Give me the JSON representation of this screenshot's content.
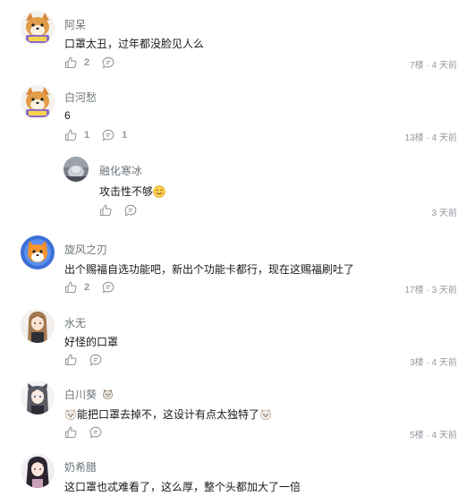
{
  "comments": [
    {
      "user": "阿呆",
      "text": "口罩太丑，过年都没脸见人么",
      "likes": "2",
      "replies": "",
      "floor": "7楼",
      "time": "4 天前",
      "avatar_icon": "shiba-dog-avatar"
    },
    {
      "user": "白河愁",
      "text": "6",
      "likes": "1",
      "replies": "1",
      "floor": "13楼",
      "time": "4 天前",
      "avatar_icon": "shiba-dog-avatar"
    },
    {
      "user": "旋风之刃",
      "text": "出个赐福自选功能吧，新出个功能卡都行，现在这赐福刷吐了",
      "likes": "2",
      "replies": "",
      "floor": "17楼",
      "time": "3 天前",
      "avatar_icon": "fox-avatar"
    },
    {
      "user": "水无",
      "text": "好怪的口罩",
      "likes": "",
      "replies": "",
      "floor": "3楼",
      "time": "4 天前",
      "avatar_icon": "anime-girl-avatar"
    },
    {
      "user": "白川葵",
      "text_before": "",
      "text": "能把口罩去掉不，这设计有点太独特了",
      "likes": "",
      "replies": "",
      "floor": "5楼",
      "time": "4 天前",
      "avatar_icon": "anime-catgirl-avatar",
      "badge_icon": "dog-face-badge",
      "emoji_icon": "dog-face-emoji"
    },
    {
      "user": "奶希腊",
      "text": "这口罩也忒难看了，这么厚，整个头都加大了一倍",
      "avatar_icon": "anime-girl-dark-hair-avatar"
    }
  ],
  "reply": {
    "user": "融化寒冰",
    "text": "攻击性不够",
    "time": "3 天前",
    "avatar_icon": "photo-avatar",
    "emoji_icon": "smiling-face-emoji"
  },
  "colors": {
    "username": "#6d757a",
    "text": "#18191c",
    "meta": "#9499a0"
  }
}
